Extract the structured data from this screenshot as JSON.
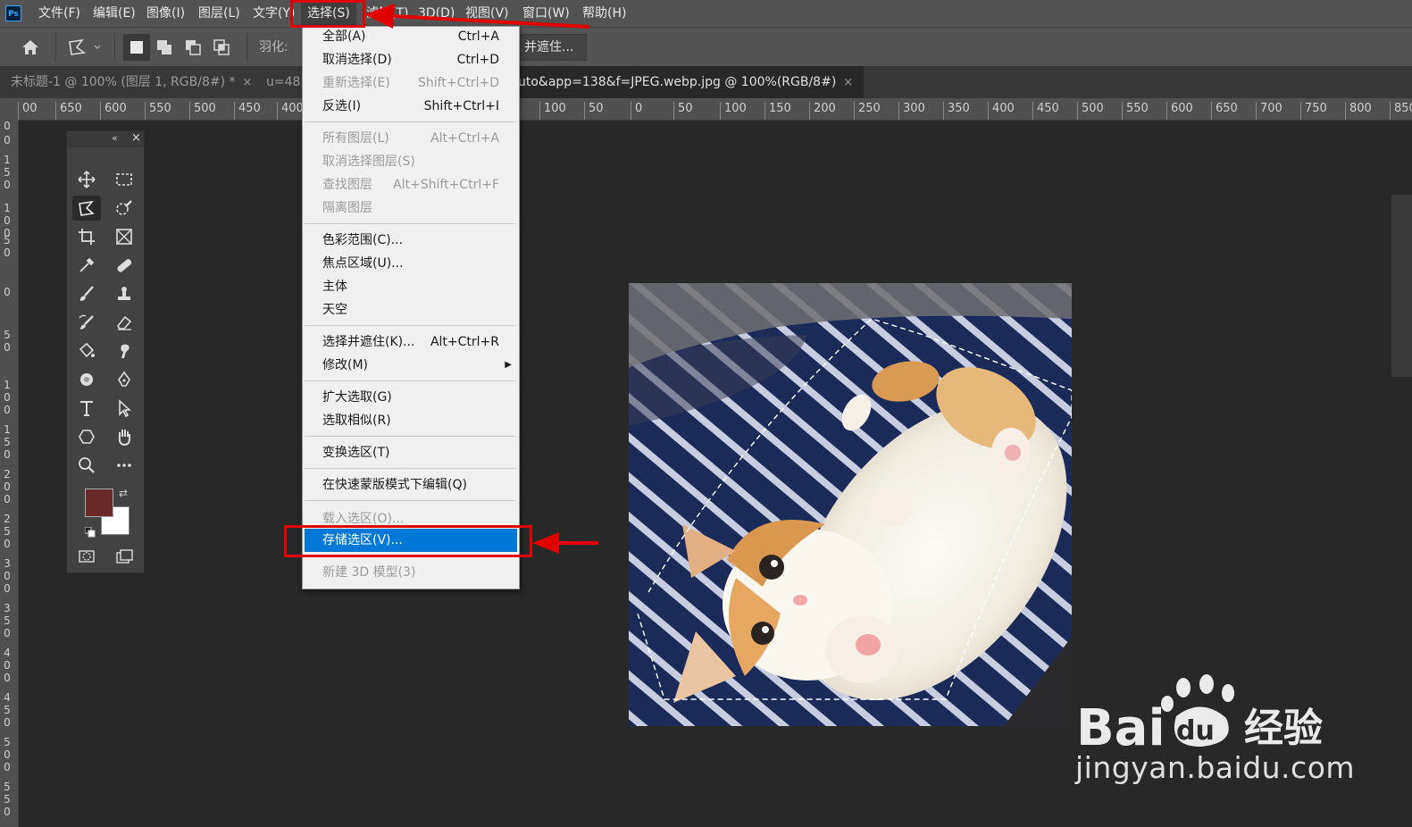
{
  "menubar": {
    "app_badge": "Ps",
    "items": [
      "文件(F)",
      "编辑(E)",
      "图像(I)",
      "图层(L)",
      "文字(Y)",
      "选择(S)",
      "滤镜(T)",
      "3D(D)",
      "视图(V)",
      "窗口(W)",
      "帮助(H)"
    ]
  },
  "options_bar": {
    "feather_label": "羽化:",
    "refine_button": "并遮住..."
  },
  "tabs": [
    {
      "label": "未标题-1 @ 100% (图层 1, RGB/8#) *",
      "close": "×"
    },
    {
      "label": "u=485",
      "close": ""
    },
    {
      "label": "uto&app=138&f=JPEG.webp.jpg @ 100%(RGB/8#)",
      "close": "×"
    }
  ],
  "ruler": {
    "h_ticks": [
      "00",
      "650",
      "600",
      "550",
      "500",
      "450",
      "400",
      "100",
      "50",
      "0",
      "50",
      "100",
      "150",
      "200",
      "250",
      "300",
      "350",
      "400",
      "450",
      "500",
      "550",
      "600",
      "650",
      "700",
      "750",
      "800",
      "850"
    ],
    "v_ticks": [
      "0",
      "0",
      "1\n5\n0",
      "1\n0\n0",
      "5\n0",
      "0",
      "5\n0",
      "1\n0\n0",
      "1\n5\n0",
      "2\n0\n0",
      "2\n5\n0",
      "3\n0\n0",
      "3\n5\n0",
      "4\n0\n0",
      "4\n5\n0",
      "5\n0\n0",
      "5\n5\n0"
    ]
  },
  "tools": {
    "header_collapse": "«",
    "header_close": "×",
    "swap_icon": "⇄"
  },
  "dropdown": {
    "items": [
      {
        "label": "全部(A)",
        "shortcut": "Ctrl+A",
        "enabled": true
      },
      {
        "label": "取消选择(D)",
        "shortcut": "Ctrl+D",
        "enabled": true
      },
      {
        "label": "重新选择(E)",
        "shortcut": "Shift+Ctrl+D",
        "enabled": false
      },
      {
        "label": "反选(I)",
        "shortcut": "Shift+Ctrl+I",
        "enabled": true
      },
      {
        "label": "所有图层(L)",
        "shortcut": "Alt+Ctrl+A",
        "enabled": false
      },
      {
        "label": "取消选择图层(S)",
        "shortcut": "",
        "enabled": false
      },
      {
        "label": "查找图层",
        "shortcut": "Alt+Shift+Ctrl+F",
        "enabled": false
      },
      {
        "label": "隔离图层",
        "shortcut": "",
        "enabled": false
      },
      {
        "label": "色彩范围(C)...",
        "shortcut": "",
        "enabled": true
      },
      {
        "label": "焦点区域(U)...",
        "shortcut": "",
        "enabled": true
      },
      {
        "label": "主体",
        "shortcut": "",
        "enabled": true
      },
      {
        "label": "天空",
        "shortcut": "",
        "enabled": true
      },
      {
        "label": "选择并遮住(K)...",
        "shortcut": "Alt+Ctrl+R",
        "enabled": true
      },
      {
        "label": "修改(M)",
        "shortcut": "",
        "enabled": true,
        "submenu": true
      },
      {
        "label": "扩大选取(G)",
        "shortcut": "",
        "enabled": true
      },
      {
        "label": "选取相似(R)",
        "shortcut": "",
        "enabled": true
      },
      {
        "label": "变换选区(T)",
        "shortcut": "",
        "enabled": true
      },
      {
        "label": "在快速蒙版模式下编辑(Q)",
        "shortcut": "",
        "enabled": true
      },
      {
        "label": "载入选区(O)...",
        "shortcut": "",
        "enabled": false
      },
      {
        "label": "存储选区(V)...",
        "shortcut": "",
        "enabled": true,
        "highlighted": true
      },
      {
        "label": "新建 3D 模型(3)",
        "shortcut": "",
        "enabled": false
      }
    ],
    "submenu_arrow": "▶"
  },
  "colors": {
    "foreground": "#6b2a2a",
    "background": "#ffffff",
    "highlight": "#0078d7",
    "annotation": "#e00000"
  },
  "watermark": {
    "brand_prefix": "Bai",
    "brand_suffix": "du",
    "brand_cn": "经验",
    "url": "jingyan.baidu.com"
  }
}
